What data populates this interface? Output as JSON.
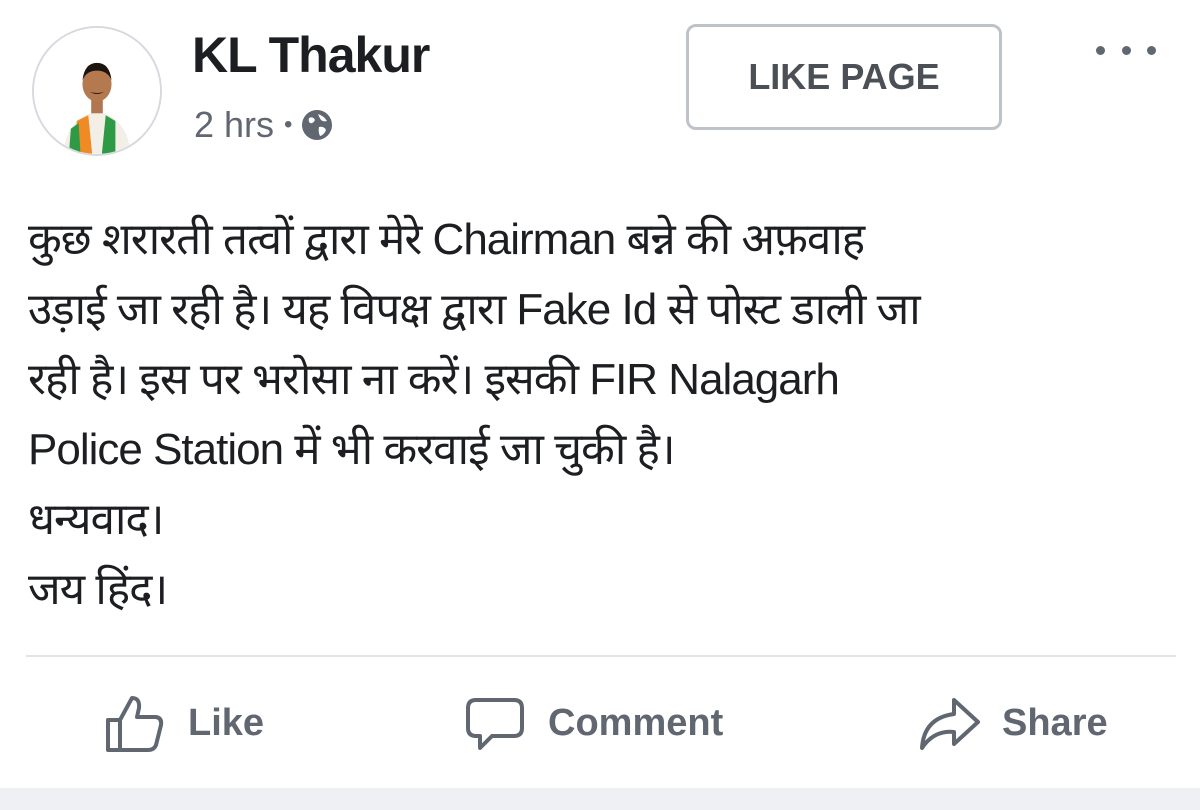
{
  "post": {
    "author": "KL Thakur",
    "timestamp": "2 hrs",
    "visibility_icon": "globe-icon",
    "like_page_label": "LIKE PAGE",
    "more_icon": "more-options-icon",
    "lines": [
      "कुछ शरारती तत्वों द्वारा मेरे Chairman बन्ने की अफ़वाह",
      "उड़ाई जा रही है। यह विपक्ष द्वारा Fake Id से पोस्ट डाली जा",
      "रही है। इस पर भरोसा ना करें। इसकी FIR Nalagarh",
      "Police Station में भी करवाई जा चुकी है।",
      "धन्यवाद।",
      "जय हिंद।"
    ]
  },
  "actions": {
    "like_label": "Like",
    "comment_label": "Comment",
    "share_label": "Share"
  },
  "colors": {
    "text_primary": "#1c1e21",
    "text_secondary": "#606770",
    "border": "#bec3c9",
    "background": "#ffffff"
  }
}
